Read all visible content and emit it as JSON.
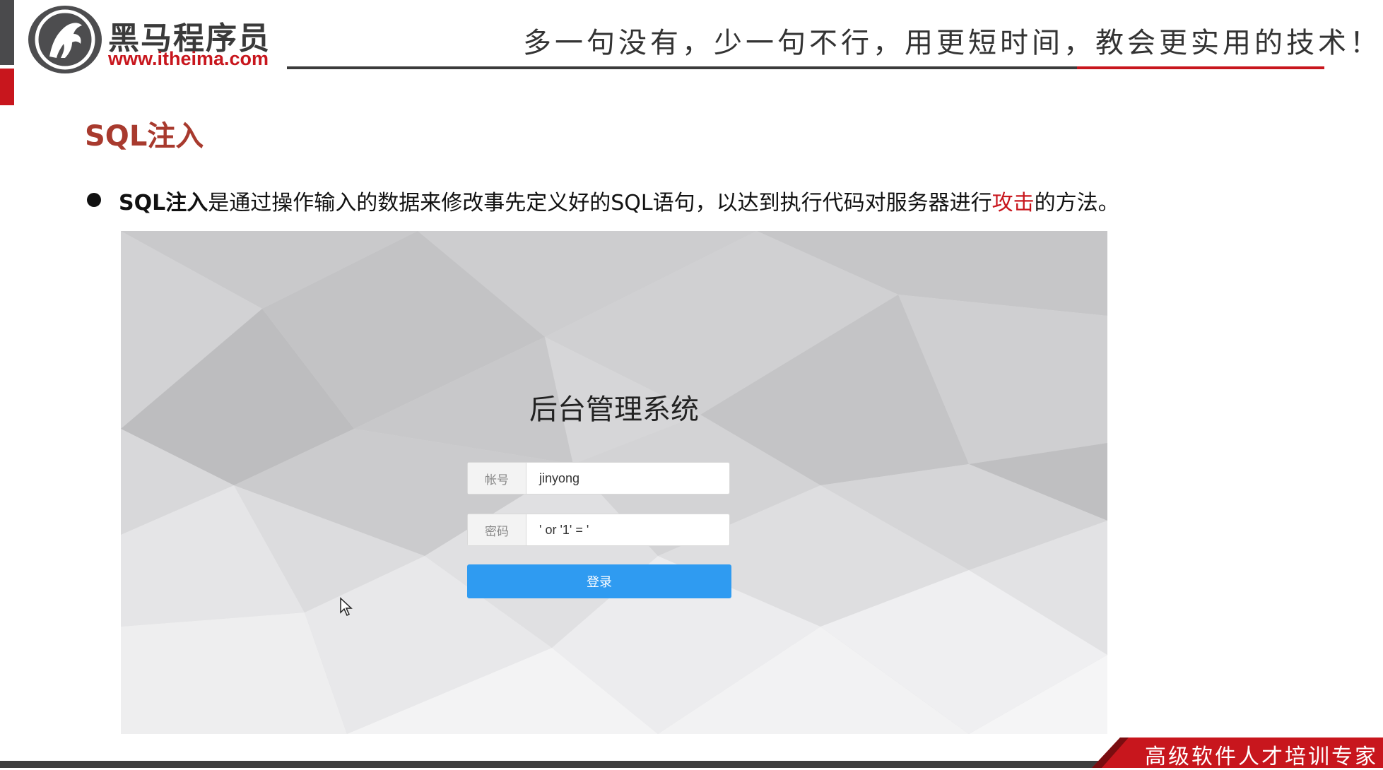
{
  "header": {
    "brand_name": "黑马程序员",
    "brand_url": "www.itheima.com",
    "slogan": "多一句没有，少一句不行，用更短时间，教会更实用的技术！"
  },
  "section": {
    "title": "SQL注入"
  },
  "bullet": {
    "term": "SQL注入",
    "text_before": "是通过操作输入的数据来修改事先定义好的SQL语句，以达到执行代码对服务器进行",
    "highlight": "攻击",
    "text_after": "的方法。"
  },
  "login": {
    "title": "后台管理系统",
    "username_label": "帐号",
    "username_value": "jinyong",
    "password_label": "密码",
    "password_value": "' or '1' = '",
    "submit_label": "登录"
  },
  "footer": {
    "tagline": "高级软件人才培训专家"
  },
  "colors": {
    "brand_red": "#c8161d",
    "title_red": "#a83a2e",
    "button_blue": "#2f9bf1"
  }
}
